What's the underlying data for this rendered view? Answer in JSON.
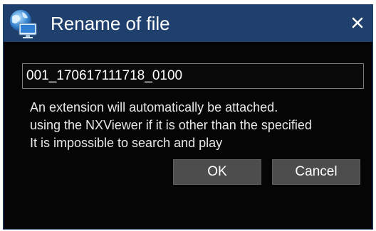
{
  "dialog": {
    "title": "Rename of file",
    "app_icon": "globe-computer-icon",
    "close_icon": "close-icon",
    "filename_value": "001_170617111718_0100",
    "message_lines": [
      "An extension will automatically be attached.",
      "using the NXViewer if it is other than the specified",
      "It is impossible to search and play"
    ],
    "ok_label": "OK",
    "cancel_label": "Cancel"
  },
  "colors": {
    "titlebar": "#1f3f6c",
    "background": "#050505",
    "button": "#4d4d4d",
    "text": "#ffffff"
  }
}
